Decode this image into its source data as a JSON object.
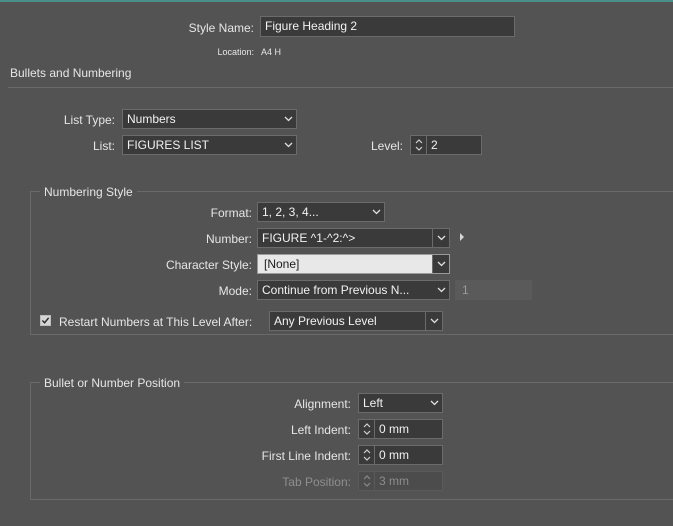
{
  "header": {
    "style_name_label": "Style Name:",
    "style_name_value": "Figure Heading 2",
    "location_label": "Location:",
    "location_value": "A4 H"
  },
  "section": {
    "title": "Bullets and Numbering"
  },
  "list_settings": {
    "list_type_label": "List Type:",
    "list_type_value": "Numbers",
    "list_label": "List:",
    "list_value": "FIGURES LIST",
    "level_label": "Level:",
    "level_value": "2"
  },
  "numbering_style": {
    "title": "Numbering Style",
    "format_label": "Format:",
    "format_value": "1, 2, 3, 4...",
    "number_label": "Number:",
    "number_value": "FIGURE ^1-^2:^>",
    "char_style_label": "Character Style:",
    "char_style_value": "[None]",
    "mode_label": "Mode:",
    "mode_value": "Continue from Previous N...",
    "mode_start_value": "1",
    "restart_label": "Restart Numbers at This Level After:",
    "restart_checked": true,
    "restart_value": "Any Previous Level"
  },
  "position": {
    "title": "Bullet or Number Position",
    "alignment_label": "Alignment:",
    "alignment_value": "Left",
    "left_indent_label": "Left Indent:",
    "left_indent_value": "0 mm",
    "first_line_label": "First Line Indent:",
    "first_line_value": "0 mm",
    "tab_position_label": "Tab Position:",
    "tab_position_value": "3 mm"
  },
  "colors": {
    "background": "#535353",
    "field": "#3a3a3a",
    "accent_top": "#4a8f8a"
  }
}
